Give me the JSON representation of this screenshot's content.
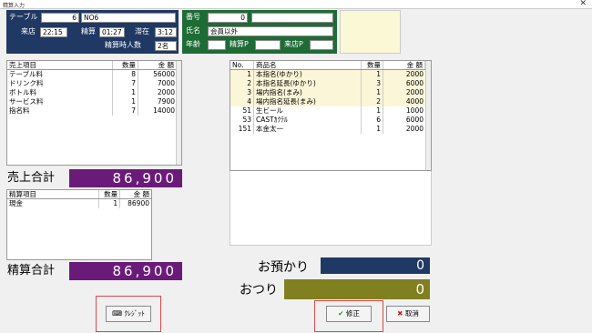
{
  "window": {
    "title": "精算入力",
    "close": "✕"
  },
  "header": {
    "table_label": "テーブル",
    "table_num": "6",
    "table_name": "NO6",
    "arrive_label": "来店",
    "arrive_time": "22:15",
    "settle_label": "精算",
    "settle_time": "01:27",
    "stay_label": "滞在",
    "stay_time": "3:12",
    "people_label": "精算時人数",
    "people_value": "2名"
  },
  "customer": {
    "number_label": "番号",
    "number_value": "0",
    "number_extra": "",
    "name_label": "氏名",
    "name_value": "会員以外",
    "age_label": "年齢",
    "age_value": "",
    "settle_p_label": "精算P",
    "settle_p_value": "",
    "visit_p_label": "来店P",
    "visit_p_value": ""
  },
  "sales": {
    "headers": [
      "売上項目",
      "数量",
      "金 額"
    ],
    "rows": [
      [
        "テーブル料",
        "8",
        "56000"
      ],
      [
        "ドリンク料",
        "7",
        "7000"
      ],
      [
        "ボトル料",
        "1",
        "2000"
      ],
      [
        "サービス料",
        "1",
        "7900"
      ],
      [
        "指名料",
        "7",
        "14000"
      ]
    ],
    "total_label": "売上合計",
    "total_value": "86,900"
  },
  "payment": {
    "headers": [
      "精算項目",
      "数量",
      "金 額"
    ],
    "rows": [
      [
        "現金",
        "1",
        "86900"
      ]
    ],
    "total_label": "精算合計",
    "total_value": "86,900"
  },
  "orders": {
    "headers": [
      "No.",
      "商品名",
      "数量",
      "金 額"
    ],
    "rows": [
      [
        "1",
        "本指名(ゆかり)",
        "1",
        "2000"
      ],
      [
        "2",
        "本指名延長(ゆかり)",
        "3",
        "6000"
      ],
      [
        "3",
        "場内指名(まみ)",
        "1",
        "2000"
      ],
      [
        "4",
        "場内指名延長(まみ)",
        "2",
        "4000"
      ],
      [
        "51",
        "生ビール",
        "1",
        "1000"
      ],
      [
        "53",
        "CASTｶｸﾃﾙ",
        "6",
        "6000"
      ],
      [
        "151",
        "本金太一",
        "1",
        "2000"
      ]
    ],
    "highlight_rows": 4
  },
  "deposit": {
    "label": "お預かり",
    "value": "0"
  },
  "change": {
    "label": "おつり",
    "value": "0"
  },
  "buttons": {
    "credit": "ｸﾚｼﾞｯﾄ",
    "modify": "修正",
    "cancel": "取消"
  },
  "colors": {
    "navy": "#1f3864",
    "green": "#1e6b36",
    "purple": "#6a1b7a",
    "olive": "#808020",
    "highlight": "#fbf6d8"
  }
}
